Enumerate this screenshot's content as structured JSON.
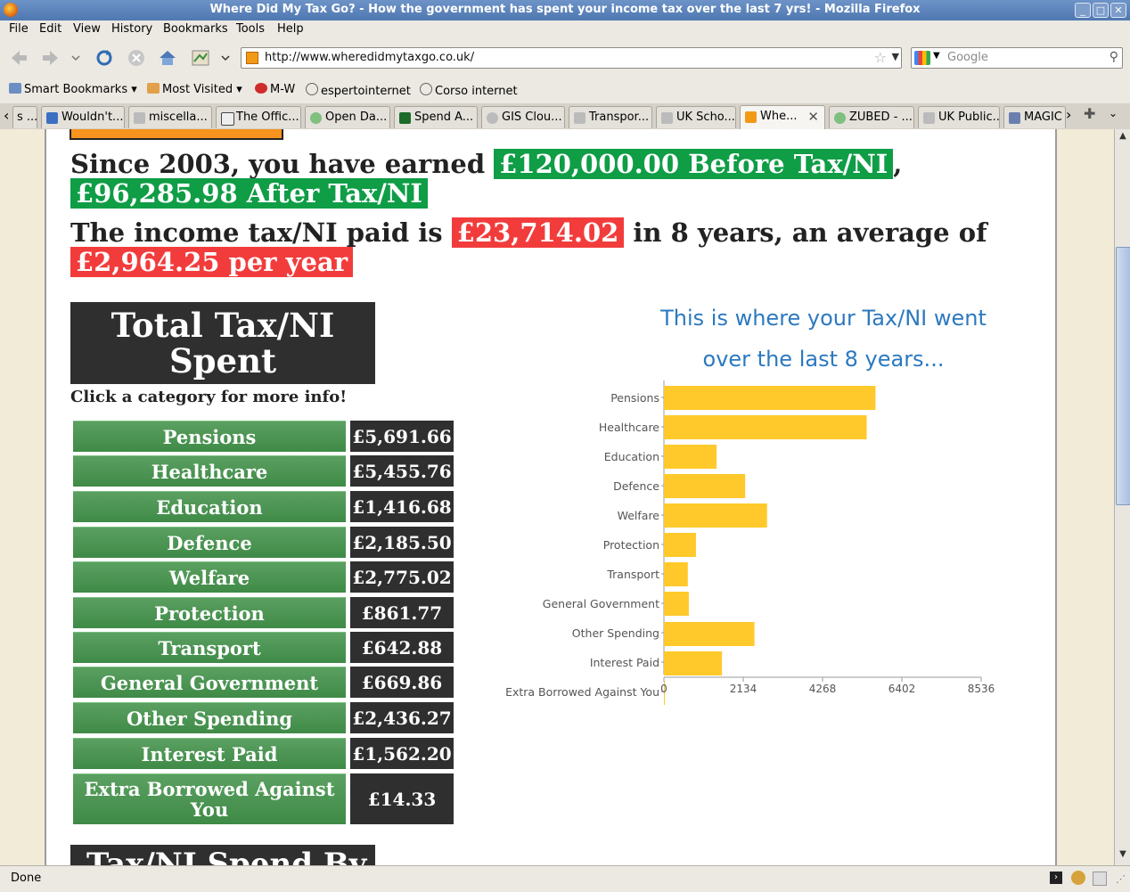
{
  "window": {
    "title": "Where Did My Tax Go? - How the government has spent your income tax over the last 7 yrs! - Mozilla Firefox"
  },
  "menu": [
    "File",
    "Edit",
    "View",
    "History",
    "Bookmarks",
    "Tools",
    "Help"
  ],
  "nav": {
    "url": "http://www.wheredidmytaxgo.co.uk/",
    "search_placeholder": "Google"
  },
  "bookmarks": [
    "Smart Bookmarks",
    "Most Visited",
    "M-W",
    "espertointernet",
    "Corso internet"
  ],
  "tabs": [
    {
      "label": "s ...",
      "active": false
    },
    {
      "label": "Wouldn't...",
      "active": false
    },
    {
      "label": "miscella...",
      "active": false
    },
    {
      "label": "The Offic...",
      "active": false
    },
    {
      "label": "Open Da...",
      "active": false
    },
    {
      "label": "Spend A...",
      "active": false
    },
    {
      "label": "GIS Clou...",
      "active": false
    },
    {
      "label": "Transpor...",
      "active": false
    },
    {
      "label": "UK Scho...",
      "active": false
    },
    {
      "label": "Whe...",
      "active": true
    },
    {
      "label": "ZUBED - ...",
      "active": false
    },
    {
      "label": "UK Public...",
      "active": false
    },
    {
      "label": "MAGIC",
      "active": false
    }
  ],
  "page": {
    "line1_pre": "Since 2003, you have earned ",
    "before_tax": "£120,000.00 Before Tax/NI",
    "comma": ", ",
    "after_tax": "£96,285.98 After Tax/NI",
    "line2_pre": "The income tax/NI paid is ",
    "tax_paid": "£23,714.02",
    "line2_mid": " in 8 years, an average of ",
    "avg": "£2,964.25 per year",
    "total_title": "Total Tax/NI Spent",
    "click_info": "Click a category for more info!",
    "categories": [
      {
        "name": "Pensions",
        "amount": "£5,691.66"
      },
      {
        "name": "Healthcare",
        "amount": "£5,455.76"
      },
      {
        "name": "Education",
        "amount": "£1,416.68"
      },
      {
        "name": "Defence",
        "amount": "£2,185.50"
      },
      {
        "name": "Welfare",
        "amount": "£2,775.02"
      },
      {
        "name": "Protection",
        "amount": "£861.77"
      },
      {
        "name": "Transport",
        "amount": "£642.88"
      },
      {
        "name": "General Government",
        "amount": "£669.86"
      },
      {
        "name": "Other Spending",
        "amount": "£2,436.27"
      },
      {
        "name": "Interest Paid",
        "amount": "£1,562.20"
      },
      {
        "name": "Extra Borrowed Against You",
        "amount": "£14.33"
      }
    ],
    "bottom_title": "Tax/NI Spend By"
  },
  "chart_data": {
    "type": "bar",
    "orientation": "horizontal",
    "title": "This is where your Tax/NI went over the last 8 years...",
    "title_lines": [
      "This is where your Tax/NI went",
      "over the last 8 years..."
    ],
    "categories": [
      "Pensions",
      "Healthcare",
      "Education",
      "Defence",
      "Welfare",
      "Protection",
      "Transport",
      "General Government",
      "Other Spending",
      "Interest Paid",
      "Extra Borrowed Against You"
    ],
    "values": [
      5691.66,
      5455.76,
      1416.68,
      2185.5,
      2775.02,
      861.77,
      642.88,
      669.86,
      2436.27,
      1562.2,
      14.33
    ],
    "xticks": [
      "0",
      "2134",
      "4268",
      "6402",
      "8536"
    ],
    "xlim": [
      0,
      8536
    ],
    "bar_color": "#ffc92b",
    "title_color": "#2c79bf",
    "grid": false
  },
  "status": {
    "text": "Done"
  },
  "colors": {
    "green_highlight": "#0f9d46",
    "red_highlight": "#f23c3c",
    "dark_box": "#2f2f2f",
    "category_green": "#4b944f"
  }
}
